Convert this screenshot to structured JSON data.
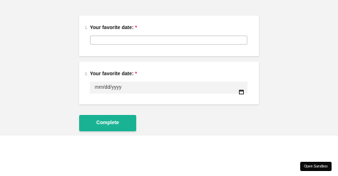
{
  "questions": [
    {
      "number": "1.",
      "title": "Your favorite date:",
      "required_mark": "*",
      "input_type": "text",
      "value": ""
    },
    {
      "number": "2.",
      "title": "Your favorite date:",
      "required_mark": "*",
      "input_type": "date",
      "placeholder": "mm/dd/yyyy"
    }
  ],
  "complete_button": {
    "label": "Complete"
  },
  "sandbox_button": {
    "label": "Open Sandbox"
  },
  "icons": {
    "date_picker": "calendar-icon"
  },
  "colors": {
    "accent": "#19b394",
    "required": "#e60a3e",
    "survey_background": "#f3f3f3",
    "sandbox_button": "#0b0b0b"
  }
}
